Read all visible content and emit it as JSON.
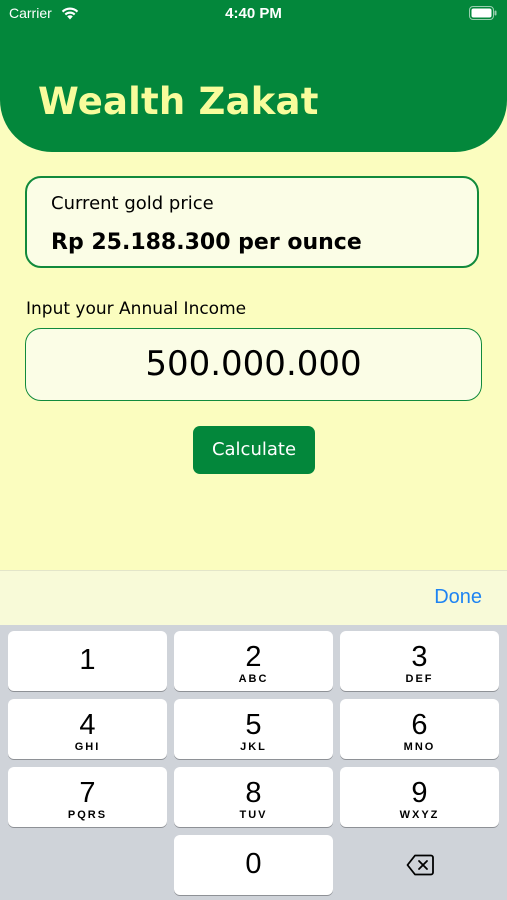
{
  "status_bar": {
    "carrier": "Carrier",
    "time": "4:40 PM"
  },
  "header": {
    "title": "Wealth Zakat"
  },
  "gold_card": {
    "label": "Current gold price",
    "value": "Rp 25.188.300 per ounce"
  },
  "income": {
    "label": "Input your Annual Income",
    "value": "500.000.000"
  },
  "calculate_button": {
    "label": "Calculate"
  },
  "keyboard": {
    "done_label": "Done",
    "keys": [
      {
        "num": "1",
        "letters": ""
      },
      {
        "num": "2",
        "letters": "ABC"
      },
      {
        "num": "3",
        "letters": "DEF"
      },
      {
        "num": "4",
        "letters": "GHI"
      },
      {
        "num": "5",
        "letters": "JKL"
      },
      {
        "num": "6",
        "letters": "MNO"
      },
      {
        "num": "7",
        "letters": "PQRS"
      },
      {
        "num": "8",
        "letters": "TUV"
      },
      {
        "num": "9",
        "letters": "WXYZ"
      },
      {
        "num": "0",
        "letters": ""
      }
    ]
  },
  "colors": {
    "header_green": "#03873b",
    "background": "#fbfdbf",
    "title_yellow": "#f8fc9c",
    "done_blue": "#1f84f2"
  }
}
